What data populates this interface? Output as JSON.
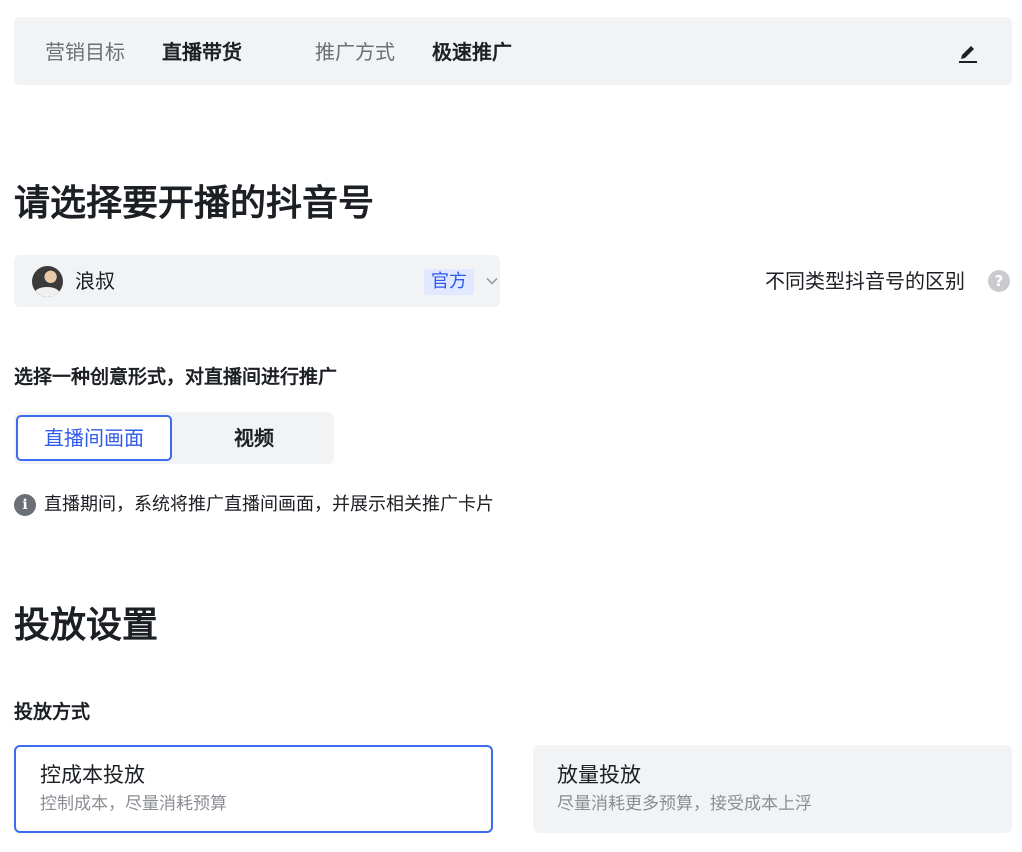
{
  "summary": {
    "goal_label": "营销目标",
    "goal_value": "直播带货",
    "method_label": "推广方式",
    "method_value": "极速推广",
    "edit_icon": "edit-pencil-icon"
  },
  "account_section": {
    "title": "请选择要开播的抖音号",
    "selected_account": {
      "name": "浪叔",
      "badge": "官方"
    },
    "diff_link": "不同类型抖音号的区别",
    "help_icon": "question-circle-icon"
  },
  "creative_section": {
    "title": "选择一种创意形式，对直播间进行推广",
    "options": [
      {
        "label": "直播间画面",
        "selected": true
      },
      {
        "label": "视频",
        "selected": false
      }
    ],
    "info_text": "直播期间，系统将推广直播间画面，并展示相关推广卡片"
  },
  "delivery_section": {
    "title": "投放设置",
    "method_title": "投放方式",
    "cards": [
      {
        "title": "控成本投放",
        "desc": "控制成本，尽量消耗预算",
        "selected": true
      },
      {
        "title": "放量投放",
        "desc": "尽量消耗更多预算，接受成本上浮",
        "selected": false
      }
    ]
  },
  "colors": {
    "accent": "#3b6cf0",
    "panel_bg": "#f2f3f5",
    "badge_bg": "#e1e8ff"
  }
}
